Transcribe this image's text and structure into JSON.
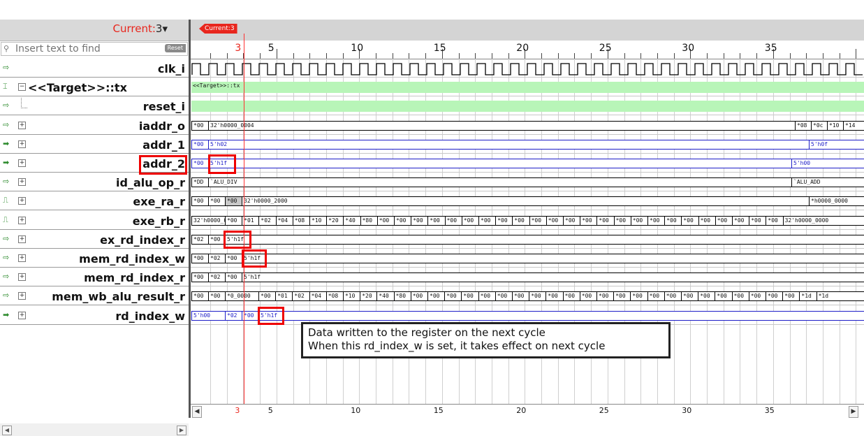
{
  "left_panel": {
    "current_label": "Current:",
    "current_value": "3",
    "dropdown_glyph": "▾",
    "search_placeholder": "Insert text to find",
    "reset_label": "Reset",
    "signals": [
      {
        "name": "clk_i",
        "icon": "input-port-icon",
        "expand": false
      },
      {
        "name": "<<Target>>::tx",
        "icon": "transaction-icon",
        "expand": true,
        "group": true
      },
      {
        "name": "reset_i",
        "icon": "input-port-icon",
        "expand": false,
        "child": true
      },
      {
        "name": "iaddr_o",
        "icon": "input-port-icon",
        "expand": true
      },
      {
        "name": "addr_1",
        "icon": "output-port-icon",
        "expand": true
      },
      {
        "name": "addr_2",
        "icon": "output-port-icon",
        "expand": true
      },
      {
        "name": "id_alu_op_r",
        "icon": "input-port-icon",
        "expand": true
      },
      {
        "name": "exe_ra_r",
        "icon": "register-icon",
        "expand": true
      },
      {
        "name": "exe_rb_r",
        "icon": "register-icon",
        "expand": true
      },
      {
        "name": "ex_rd_index_r",
        "icon": "input-port-icon",
        "expand": true
      },
      {
        "name": "mem_rd_index_w",
        "icon": "input-port-icon",
        "expand": true
      },
      {
        "name": "mem_rd_index_r",
        "icon": "input-port-icon",
        "expand": true
      },
      {
        "name": "mem_wb_alu_result_r",
        "icon": "input-port-icon",
        "expand": true
      },
      {
        "name": "rd_index_w",
        "icon": "output-port-icon",
        "expand": true
      }
    ]
  },
  "waveform": {
    "cursor_tag": "Current:3",
    "top_ruler_labels": [
      "3",
      "5",
      "10",
      "15",
      "20",
      "25",
      "30",
      "35"
    ],
    "bottom_ruler_labels": [
      "3",
      "5",
      "10",
      "15",
      "20",
      "25",
      "30",
      "35"
    ],
    "tx_label": "<<Target>>::tx",
    "rows": {
      "iaddr_o": [
        "*00",
        "32'h0000_0004",
        "*08",
        "*0c",
        "*10",
        "*14"
      ],
      "addr_1": [
        "*00",
        "5'h02",
        "5'h0f"
      ],
      "addr_2": [
        "*00",
        "5'h1f",
        "5'h00"
      ],
      "id_alu_op_r": [
        "*DD",
        "`ALU_DIV",
        "`ALU_ADD"
      ],
      "exe_ra_r": [
        "*00",
        "*00",
        "*00",
        "32'h0000_2000",
        "*h0000_0000"
      ],
      "exe_rb_r": [
        "32'h0000_0000",
        "*00",
        "*01",
        "*02",
        "*04",
        "*08",
        "*10",
        "*20",
        "*40",
        "*80",
        "*00",
        "*00",
        "*00",
        "*00",
        "*00",
        "*00",
        "*00",
        "*00",
        "*00",
        "*00",
        "*00",
        "*00",
        "*00",
        "*00",
        "*00",
        "*00",
        "*00",
        "*00",
        "*00",
        "*00",
        "*00",
        "*00",
        "*00",
        "*00",
        "32'h0000_0000"
      ],
      "ex_rd_index_r": [
        "*02",
        "*00",
        "5'h1f"
      ],
      "mem_rd_index_w": [
        "*00",
        "*02",
        "*00",
        "5'h1f"
      ],
      "mem_rd_index_r": [
        "*00",
        "*02",
        "*00",
        "5'h1f"
      ],
      "mem_wb_alu_result_r": [
        "*00",
        "*00",
        "*0_0000",
        "*00",
        "*01",
        "*02",
        "*04",
        "*08",
        "*10",
        "*20",
        "*40",
        "*80",
        "*00",
        "*00",
        "*00",
        "*00",
        "*00",
        "*00",
        "*00",
        "*00",
        "*00",
        "*00",
        "*00",
        "*00",
        "*00",
        "*00",
        "*00",
        "*00",
        "*00",
        "*00",
        "*00",
        "*00",
        "*00",
        "*00",
        "*00",
        "*1d",
        "*1d"
      ],
      "rd_index_w": [
        "5'h00",
        "*02",
        "*00",
        "5'h1f"
      ]
    },
    "note_line_1": "Data written to the register on the next cycle",
    "note_line_2": "When this rd_index_w is set, it takes effect on next cycle"
  },
  "colors": {
    "cursor": "#ff3030",
    "highlight_box": "#e00000",
    "bus_blue": "#1d1dc7",
    "tx_green": "#b8f5b8"
  }
}
